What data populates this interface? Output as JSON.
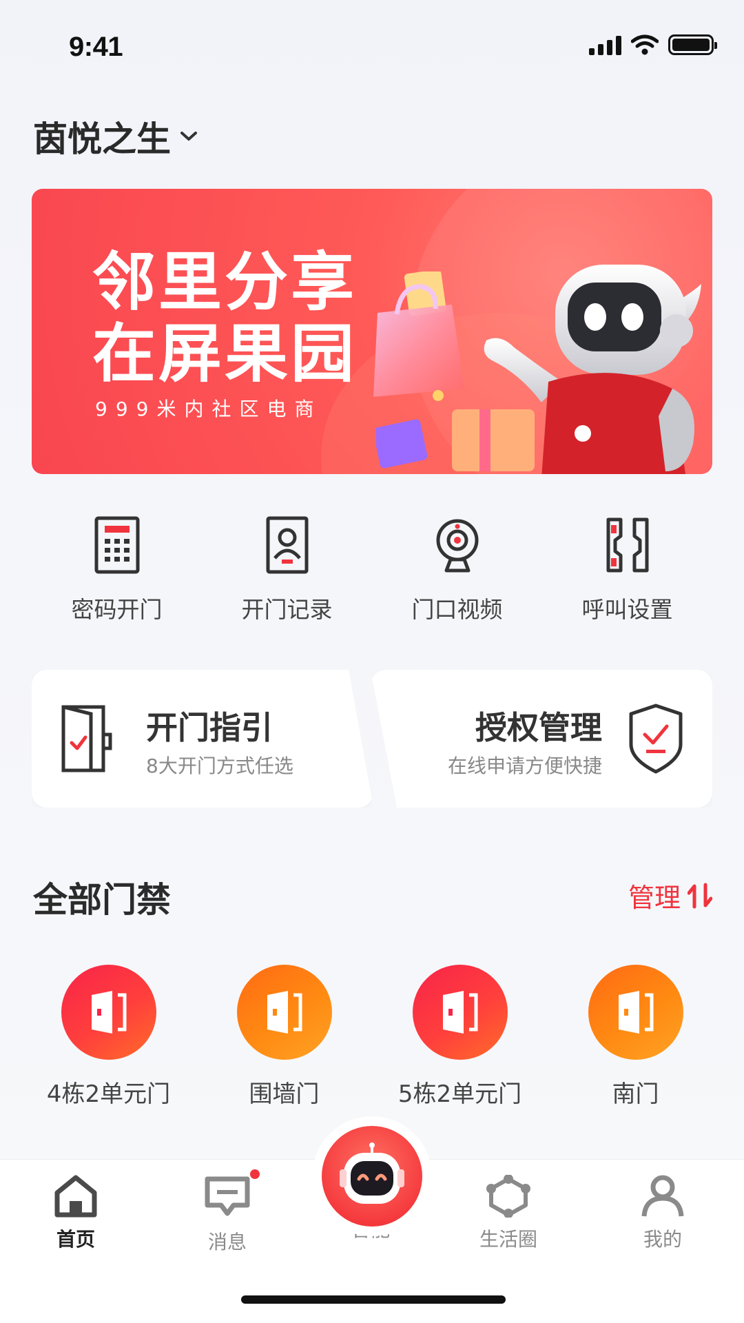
{
  "status_bar": {
    "time": "9:41"
  },
  "header": {
    "community_name": "茵悦之生"
  },
  "banner": {
    "title": "邻里分享\n在屏果园",
    "subtitle": "999米内社区电商"
  },
  "quick_actions": [
    {
      "label": "密码开门",
      "icon": "keypad-icon"
    },
    {
      "label": "开门记录",
      "icon": "person-record-icon"
    },
    {
      "label": "门口视频",
      "icon": "camera-icon"
    },
    {
      "label": "呼叫设置",
      "icon": "phone-settings-icon"
    }
  ],
  "cards": {
    "guide": {
      "title": "开门指引",
      "subtitle": "8大开门方式任选",
      "icon": "door-check-icon"
    },
    "auth": {
      "title": "授权管理",
      "subtitle": "在线申请方便快捷",
      "icon": "shield-check-icon"
    }
  },
  "section": {
    "title": "全部门禁",
    "manage_label": "管理"
  },
  "doors": [
    {
      "label": "4栋2单元门",
      "color": "#f8244a"
    },
    {
      "label": "围墙门",
      "color": "#ff8a12"
    },
    {
      "label": "5栋2单元门",
      "color": "#f8244a"
    },
    {
      "label": "南门",
      "color": "#ff8a12"
    }
  ],
  "tabbar": {
    "home": "首页",
    "messages": "消息",
    "smart": "智能",
    "life": "生活圈",
    "mine": "我的"
  },
  "colors": {
    "accent": "#f0343e",
    "orange": "#ff8a12"
  }
}
